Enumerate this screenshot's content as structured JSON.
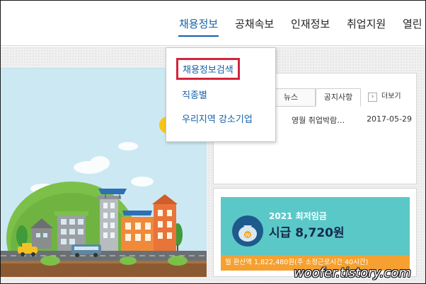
{
  "nav": {
    "items": [
      {
        "label": "채용정보",
        "active": true
      },
      {
        "label": "공채속보",
        "active": false
      },
      {
        "label": "인재정보",
        "active": false
      },
      {
        "label": "취업지원",
        "active": false
      },
      {
        "label": "열린",
        "active": false
      }
    ]
  },
  "dropdown": {
    "items": [
      {
        "label": "채용정보검색",
        "highlighted": true
      },
      {
        "label": "직종별",
        "highlighted": false
      },
      {
        "label": "우리지역 강소기업",
        "highlighted": false
      }
    ]
  },
  "notice": {
    "tabs": [
      {
        "label": "뉴스",
        "active": false
      },
      {
        "label": "공지사항",
        "active": true
      }
    ],
    "more_label": "더보기",
    "more_icon": "chevron-right-icon",
    "rows": [
      {
        "title": "영월 취업박람…",
        "date": "2017-05-29"
      }
    ]
  },
  "wage": {
    "year_label": "2021 최저임금",
    "amount": "시급 8,720원",
    "monthly": "월 환산액 1,822,480원(주 소정근로시간 40시간)",
    "bag_icon": "money-bag-icon",
    "bag_letter": "W"
  },
  "watermark": "woofer.tistory.com",
  "colors": {
    "accent": "#1460a8",
    "highlight_border": "#d4243c",
    "wage_bg": "#5bc8c8",
    "wage_strip": "#f5a030",
    "hero_sky": "#cce8f3"
  }
}
